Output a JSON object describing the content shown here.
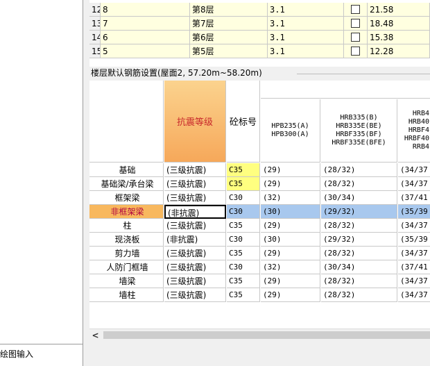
{
  "top_table": {
    "rows": [
      {
        "num": "12",
        "floor": "8",
        "name": "第8层",
        "height": "3.1",
        "elev": "21.58"
      },
      {
        "num": "13",
        "floor": "7",
        "name": "第7层",
        "height": "3.1",
        "elev": "18.48"
      },
      {
        "num": "14",
        "floor": "6",
        "name": "第6层",
        "height": "3.1",
        "elev": "15.38"
      },
      {
        "num": "15",
        "floor": "5",
        "name": "第5层",
        "height": "3.1",
        "elev": "12.28"
      }
    ]
  },
  "section_title": "楼层默认钢筋设置(屋面2, 57.20m~58.20m)",
  "rebar_table": {
    "headers": {
      "seismic": "抗震等级",
      "concrete": "砼标号",
      "hpb": [
        "HPB235(A)",
        "HPB300(A)"
      ],
      "hrb335": [
        "HRB335(B)",
        "HRB335E(BE)",
        "HRBF335(BF)",
        "HRBF335E(BFE)"
      ],
      "hrb400": [
        "HRB4",
        "HRB40",
        "HRBF4",
        "HRBF40",
        "RRB4"
      ]
    },
    "rows": [
      {
        "name": "基础",
        "seismic": "(三级抗震)",
        "concrete": "C35",
        "hpb": "(29)",
        "hrb335": "(28/32)",
        "hrb400": "(34/37"
      },
      {
        "name": "基础梁/承台梁",
        "seismic": "(三级抗震)",
        "concrete": "C35",
        "hpb": "(29)",
        "hrb335": "(28/32)",
        "hrb400": "(34/37"
      },
      {
        "name": "框架梁",
        "seismic": "(三级抗震)",
        "concrete": "C30",
        "hpb": "(32)",
        "hrb335": "(30/34)",
        "hrb400": "(37/41"
      },
      {
        "name": "非框架梁",
        "seismic": "(非抗震)",
        "concrete": "C30",
        "hpb": "(30)",
        "hrb335": "(29/32)",
        "hrb400": "(35/39"
      },
      {
        "name": "柱",
        "seismic": "(三级抗震)",
        "concrete": "C35",
        "hpb": "(29)",
        "hrb335": "(28/32)",
        "hrb400": "(34/37"
      },
      {
        "name": "现浇板",
        "seismic": "(非抗震)",
        "concrete": "C30",
        "hpb": "(30)",
        "hrb335": "(29/32)",
        "hrb400": "(35/39"
      },
      {
        "name": "剪力墙",
        "seismic": "(三级抗震)",
        "concrete": "C35",
        "hpb": "(29)",
        "hrb335": "(28/32)",
        "hrb400": "(34/37"
      },
      {
        "name": "人防门框墙",
        "seismic": "(三级抗震)",
        "concrete": "C30",
        "hpb": "(32)",
        "hrb335": "(30/34)",
        "hrb400": "(37/41"
      },
      {
        "name": "墙梁",
        "seismic": "(三级抗震)",
        "concrete": "C35",
        "hpb": "(29)",
        "hrb335": "(28/32)",
        "hrb400": "(34/37"
      },
      {
        "name": "墙柱",
        "seismic": "(三级抗震)",
        "concrete": "C35",
        "hpb": "(29)",
        "hrb335": "(28/32)",
        "hrb400": "(34/37"
      }
    ]
  },
  "scroll_left": "<",
  "sidebar_bottom_label": "绘图输入",
  "colors": {
    "row_yellow": "#ffffe0",
    "highlight_yellow": "#ffff80",
    "header_orange": "#f8b85e",
    "selected_row_blue": "#a8c8ee",
    "selected_name_orange": "#f8b85e",
    "selected_name_text": "#b00040",
    "header_red_text": "#c8282c"
  }
}
